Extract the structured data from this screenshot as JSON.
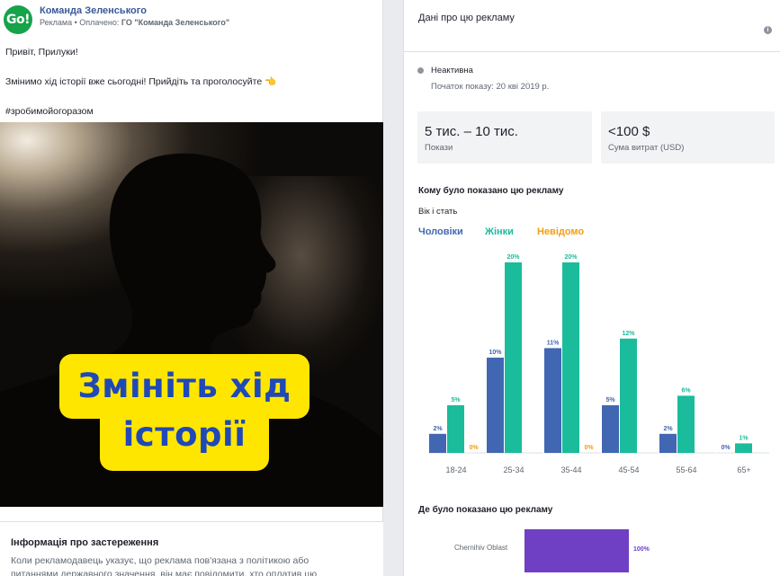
{
  "ad": {
    "logo_text": "Go!",
    "page_name": "Команда Зеленського",
    "sponsor_prefix": "Реклама • Оплачено: ",
    "sponsor_name": "ГО \"Команда Зеленського\"",
    "greeting": "Привіт, Прилуки!",
    "message": "Змінимо хід історії вже сьогодні! Прийдіть та проголосуйте 👈",
    "hashtag": "#зробимойогоразом",
    "banner_line1": "Змініть хід",
    "banner_line2": "історії",
    "colors": {
      "banner": "#ffe600",
      "banner_text": "#1f49b7",
      "logo": "#16a34a"
    }
  },
  "disclaimer": {
    "title": "Інформація про застереження",
    "text": "Коли рекламодавець указує, що реклама пов'язана з політикою або питаннями державного значення, він має повідомити, хто оплатив цю"
  },
  "info": {
    "title": "Дані про цю рекламу",
    "info_icon": "info-icon",
    "status": "Неактивна",
    "start_date": "Початок показу: 20 квi 2019 р.",
    "impressions_value": "5 тис. – 10 тис.",
    "impressions_label": "Покази",
    "spend_value": "<100 $",
    "spend_label": "Сума витрат (USD)",
    "audience_title": "Кому було показано цю рекламу",
    "age_gender_label": "Вік і стать",
    "legend": {
      "men": "Чоловіки",
      "women": "Жінки",
      "unknown": "Невідомо"
    },
    "region_title": "Де було показано цю рекламу",
    "region_name": "Chernihiv Oblast",
    "region_pct": "100%",
    "region_share": 100
  },
  "chart_data": {
    "type": "bar",
    "categories": [
      "18-24",
      "25-34",
      "35-44",
      "45-54",
      "55-64",
      "65+"
    ],
    "series": [
      {
        "name": "Чоловіки",
        "color": "#4267b2",
        "values": [
          2,
          10,
          11,
          5,
          2,
          0
        ]
      },
      {
        "name": "Жінки",
        "color": "#1abc9c",
        "values": [
          5,
          20,
          20,
          12,
          6,
          1
        ]
      },
      {
        "name": "Невідомо",
        "color": "#f39c12",
        "values": [
          0,
          null,
          0,
          null,
          null,
          null
        ]
      }
    ],
    "ylim": [
      0,
      20
    ],
    "grid": false,
    "legend": "top-left"
  }
}
